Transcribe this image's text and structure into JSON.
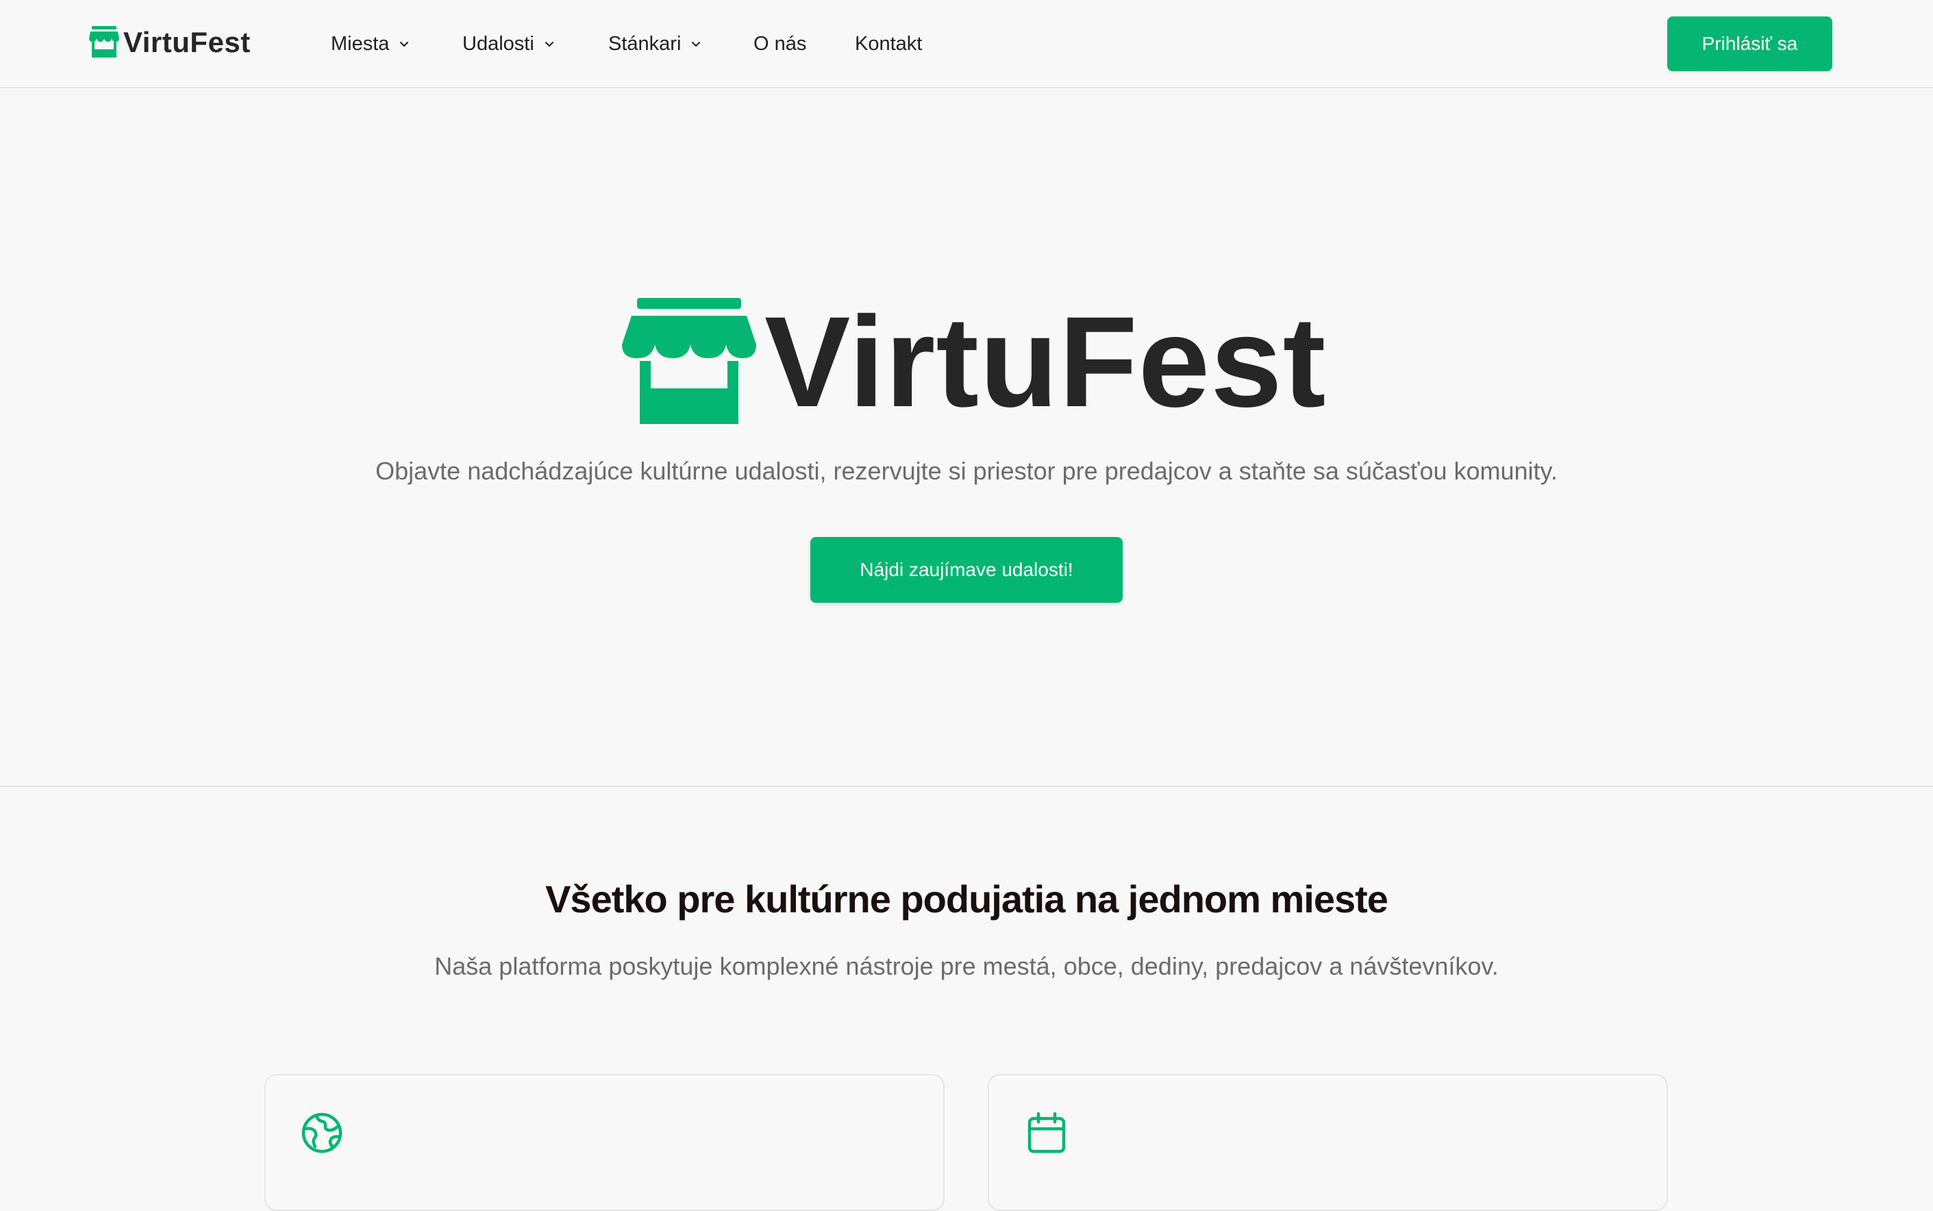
{
  "brand": {
    "name": "VirtuFest",
    "logo_icon": "market-stall-icon",
    "accent_color": "#04b671"
  },
  "nav": {
    "items": [
      {
        "label": "Miesta",
        "dropdown": true
      },
      {
        "label": "Udalosti",
        "dropdown": true
      },
      {
        "label": "Stánkari",
        "dropdown": true
      },
      {
        "label": "O nás",
        "dropdown": false
      },
      {
        "label": "Kontakt",
        "dropdown": false
      }
    ],
    "login_label": "Prihlásiť sa"
  },
  "hero": {
    "title": "VirtuFest",
    "subtitle": "Objavte nadchádzajúce kultúrne udalosti, rezervujte si priestor pre predajcov a staňte sa súčasťou komunity.",
    "cta_label": "Nájdi zaujímave udalosti!"
  },
  "features": {
    "title": "Všetko pre kultúrne podujatia na jednom mieste",
    "subtitle": "Naša platforma poskytuje komplexné nástroje pre mestá, obce, dediny, predajcov a návštevníkov.",
    "cards": [
      {
        "icon": "globe-icon"
      },
      {
        "icon": "calendar-icon"
      }
    ]
  }
}
